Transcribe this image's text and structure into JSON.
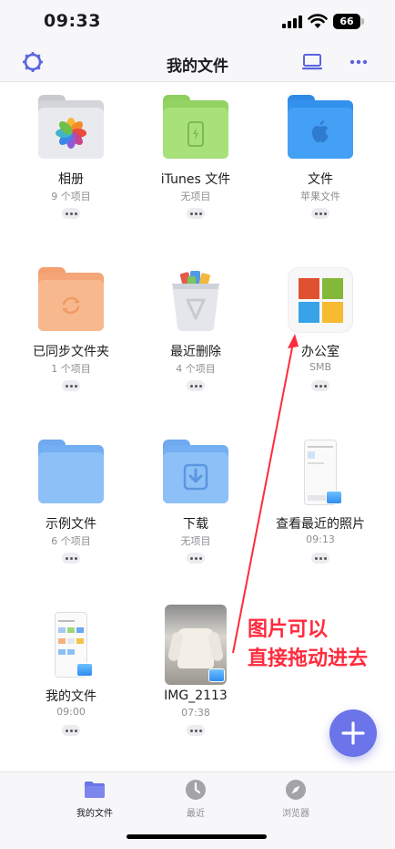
{
  "status": {
    "time": "09:33",
    "battery": "66"
  },
  "nav": {
    "title": "我的文件"
  },
  "grid": {
    "items": [
      {
        "title": "相册",
        "subtitle": "9 个项目"
      },
      {
        "title": "iTunes 文件",
        "subtitle": "无项目"
      },
      {
        "title": "文件",
        "subtitle": "苹果文件"
      },
      {
        "title": "已同步文件夹",
        "subtitle": "1 个项目"
      },
      {
        "title": "最近删除",
        "subtitle": "4 个项目"
      },
      {
        "title": "办公室",
        "subtitle": "SMB"
      },
      {
        "title": "示例文件",
        "subtitle": "6 个项目"
      },
      {
        "title": "下载",
        "subtitle": "无项目"
      },
      {
        "title": "查看最近的照片",
        "subtitle": "09:13"
      },
      {
        "title": "我的文件",
        "subtitle": "09:00"
      },
      {
        "title": "IMG_2113",
        "subtitle": "07:38"
      }
    ]
  },
  "annotation": {
    "line1": "图片可以",
    "line2": "直接拖动进去"
  },
  "tabs": [
    {
      "label": "我的文件",
      "icon": "folder-icon",
      "active": true
    },
    {
      "label": "最近",
      "icon": "clock-icon",
      "active": false
    },
    {
      "label": "浏览器",
      "icon": "compass-icon",
      "active": false
    }
  ],
  "colors": {
    "accent": "#6b74e8",
    "annotation": "#ff2b3d"
  }
}
